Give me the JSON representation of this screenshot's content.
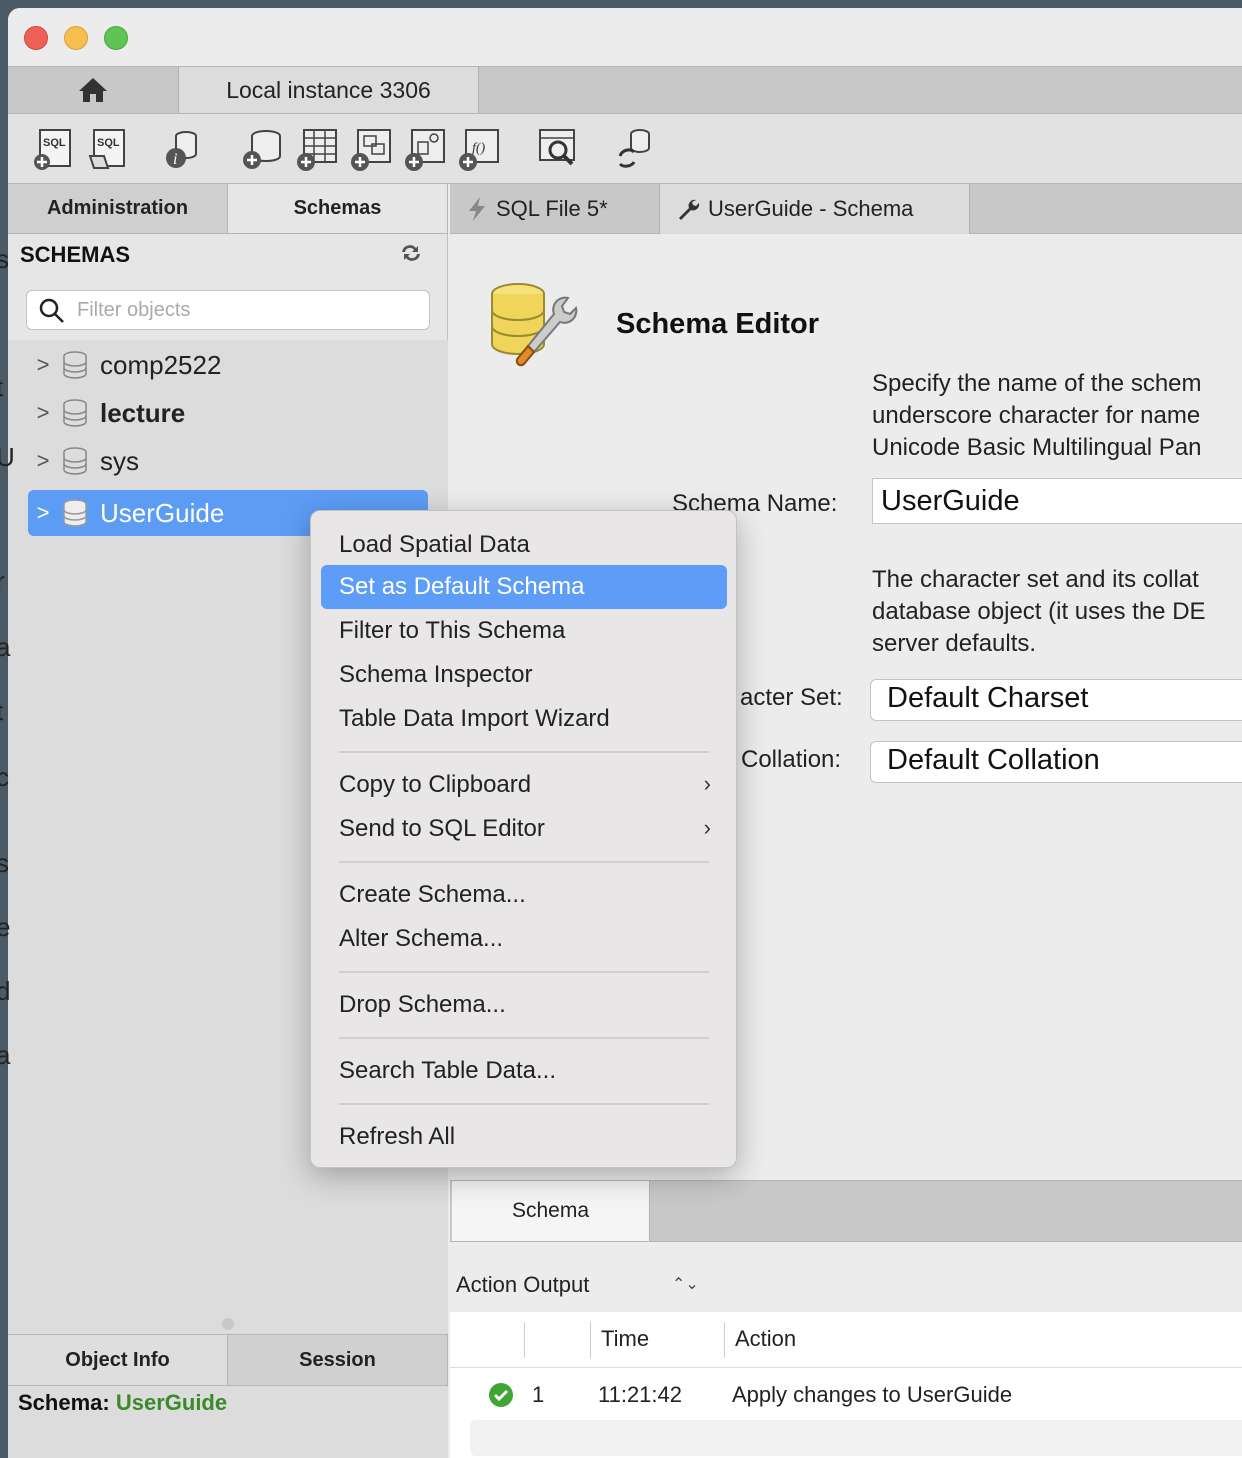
{
  "window": {
    "connection_tab": "Local instance 3306"
  },
  "sidebar": {
    "tabs": [
      "Administration",
      "Schemas"
    ],
    "header": "SCHEMAS",
    "filter_placeholder": "Filter objects",
    "schemas": [
      {
        "name": "comp2522",
        "bold": false,
        "selected": false
      },
      {
        "name": "lecture",
        "bold": true,
        "selected": false
      },
      {
        "name": "sys",
        "bold": false,
        "selected": false
      },
      {
        "name": "UserGuide",
        "bold": false,
        "selected": true
      }
    ],
    "bottom_tabs": [
      "Object Info",
      "Session"
    ],
    "object_info": {
      "label": "Schema:",
      "value": "UserGuide"
    }
  },
  "editor_tabs": {
    "sql_file": "SQL File 5*",
    "schema_tab": "UserGuide - Schema"
  },
  "editor": {
    "title": "Schema Editor",
    "desc1": [
      "Specify the name of the schem",
      "underscore character for name",
      "Unicode Basic Multilingual Pan"
    ],
    "schema_name_label": "Schema Name:",
    "schema_name_value": "UserGuide",
    "desc2": [
      "The character set and its collat",
      "database object (it uses the DE",
      "server defaults."
    ],
    "charset_label": "acter Set:",
    "charset_value": "Default Charset",
    "collation_label": "Collation:",
    "collation_value": "Default Collation"
  },
  "schema_tabbar": {
    "tab": "Schema"
  },
  "action_output": {
    "header": "Action Output",
    "updown": "⌃⌄",
    "columns": [
      "Time",
      "Action"
    ],
    "rows": [
      {
        "index": "1",
        "time": "11:21:42",
        "action": "Apply changes to UserGuide",
        "status": "ok"
      }
    ]
  },
  "context_menu": {
    "items": [
      {
        "label": "Load Spatial Data"
      },
      {
        "label": "Set as Default Schema",
        "highlight": true
      },
      {
        "label": "Filter to This Schema"
      },
      {
        "label": "Schema Inspector"
      },
      {
        "label": "Table Data Import Wizard"
      },
      {
        "label": "Copy to Clipboard",
        "submenu": true
      },
      {
        "label": "Send to SQL Editor",
        "submenu": true
      },
      {
        "label": "Create Schema..."
      },
      {
        "label": "Alter Schema..."
      },
      {
        "label": "Drop Schema..."
      },
      {
        "label": "Search Table Data..."
      },
      {
        "label": "Refresh All"
      }
    ],
    "submenu_glyph": "›"
  },
  "edge_letters": [
    "s",
    "t",
    "U",
    "i",
    "r",
    "a",
    "t",
    "c",
    "s",
    "e",
    "d",
    "a"
  ],
  "colors": {
    "accent": "#5e9df7",
    "selection": "#5d9cf5",
    "object_info_value": "#3a8a2c"
  }
}
